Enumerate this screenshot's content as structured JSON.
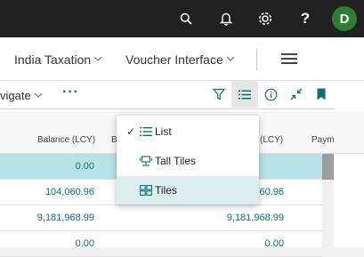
{
  "topbar": {
    "search_icon": "search-icon",
    "bell_icon": "bell-icon",
    "settings_icon": "gear-icon",
    "help_label": "?",
    "avatar_initial": "D",
    "avatar_color": "#2e7d32"
  },
  "nav": {
    "items": [
      {
        "label": "India Taxation"
      },
      {
        "label": "Voucher Interface"
      }
    ]
  },
  "actions": {
    "navigate_label": "vigate",
    "more_label": "···"
  },
  "grid": {
    "columns": [
      "Balance (LCY)",
      "B",
      "(LCY)",
      "Paym"
    ],
    "rows": [
      {
        "balance": "0.00",
        "col3": ""
      },
      {
        "balance": "104,060.96",
        "col3": "60.96"
      },
      {
        "balance": "9,181,968.99",
        "col3": "9,181,968.99"
      },
      {
        "balance": "0.00",
        "col3": "0.00"
      }
    ]
  },
  "menu": {
    "items": [
      {
        "label": "List",
        "checked": true,
        "icon": "list-icon"
      },
      {
        "label": "Tall Tiles",
        "checked": false,
        "icon": "tall-tiles-icon"
      },
      {
        "label": "Tiles",
        "checked": false,
        "icon": "tiles-icon"
      }
    ],
    "check_mark": "✓"
  },
  "colors": {
    "accent": "#0a6f74",
    "selected_row": "#b7e3e6",
    "menu_hover": "#dcedee"
  }
}
